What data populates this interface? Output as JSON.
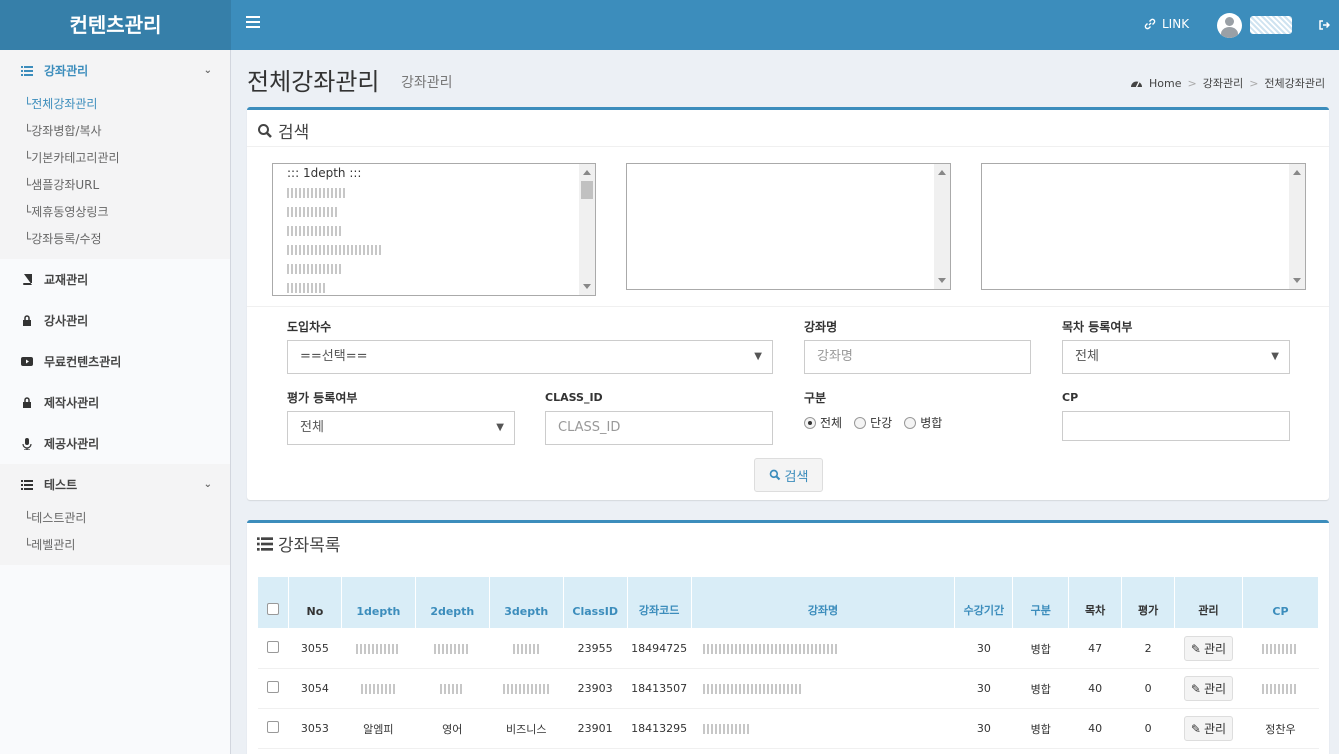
{
  "header": {
    "brand": "컨텐츠관리",
    "link_label": "LINK"
  },
  "sidebar": {
    "groups": [
      {
        "label": "강좌관리",
        "active": true,
        "items": [
          "전체강좌관리",
          "강좌병합/복사",
          "기본카테고리관리",
          "샘플강좌URL",
          "제휴동영상링크",
          "강좌등록/수정"
        ]
      },
      {
        "label": "교재관리"
      },
      {
        "label": "강사관리"
      },
      {
        "label": "무료컨텐츠관리"
      },
      {
        "label": "제작사관리"
      },
      {
        "label": "제공사관리"
      },
      {
        "label": "테스트",
        "items": [
          "테스트관리",
          "레벨관리"
        ]
      }
    ]
  },
  "page": {
    "title": "전체강좌관리",
    "subtitle": "강좌관리",
    "breadcrumb": [
      "Home",
      "강좌관리",
      "전체강좌관리"
    ]
  },
  "search": {
    "title": "검색",
    "depth1_first": "::: 1depth :::",
    "fields": {
      "intro_label": "도입차수",
      "intro_value": "==선택==",
      "course_name_label": "강좌명",
      "course_name_placeholder": "강좌명",
      "toc_label": "목차 등록여부",
      "toc_value": "전체",
      "eval_label": "평가 등록여부",
      "eval_value": "전체",
      "class_id_label": "CLASS_ID",
      "class_id_placeholder": "CLASS_ID",
      "type_label": "구분",
      "type_options": [
        "전체",
        "단강",
        "병합"
      ],
      "cp_label": "CP"
    },
    "button_label": "검색"
  },
  "list": {
    "title": "강좌목록",
    "columns": [
      "No",
      "1depth",
      "2depth",
      "3depth",
      "ClassID",
      "강좌코드",
      "강좌명",
      "수강기간",
      "구분",
      "목차",
      "평가",
      "관리",
      "CP"
    ],
    "rows": [
      {
        "no": "3055",
        "d1": "",
        "d2": "",
        "d3": "",
        "class_id": "23955",
        "code": "18494725",
        "name": "",
        "period": "30",
        "type": "병합",
        "toc": "47",
        "eval": "2",
        "cp": ""
      },
      {
        "no": "3054",
        "d1": "",
        "d2": "",
        "d3": "",
        "class_id": "23903",
        "code": "18413507",
        "name": "",
        "period": "30",
        "type": "병합",
        "toc": "40",
        "eval": "0",
        "cp": ""
      },
      {
        "no": "3053",
        "d1": "알엠피",
        "d2": "영어",
        "d3": "비즈니스",
        "class_id": "23901",
        "code": "18413295",
        "name": "",
        "period": "30",
        "type": "병합",
        "toc": "40",
        "eval": "0",
        "cp": "정찬우"
      }
    ],
    "manage_label": "관리"
  }
}
